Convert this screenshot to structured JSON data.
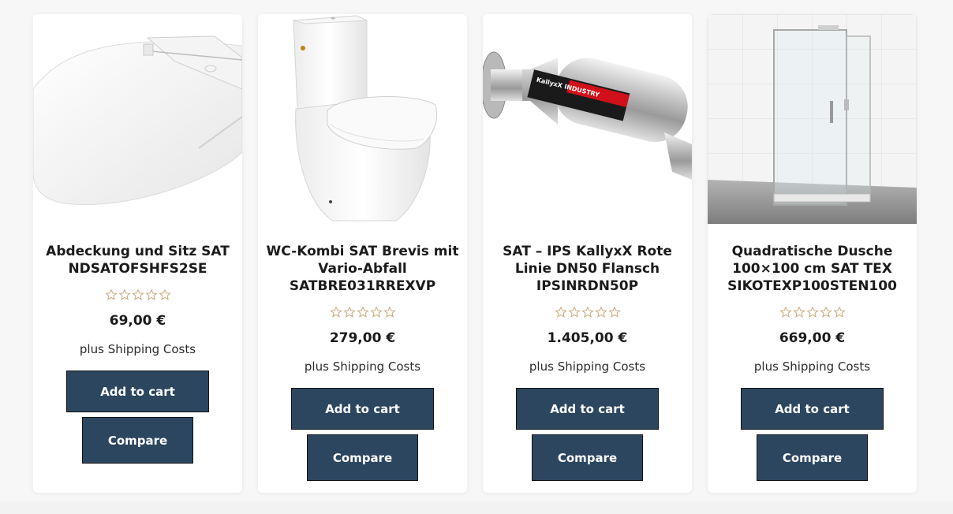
{
  "products": [
    {
      "title": "Abdeckung und Sitz SAT NDSATOFSHFS2SE",
      "price": "69,00 €",
      "shipping_prefix": "plus",
      "shipping_link": "Shipping Costs",
      "rating": 0,
      "add_to_cart": "Add to cart",
      "compare": "Compare",
      "image_icon": "toilet-seat-image"
    },
    {
      "title": "WC-Kombi SAT Brevis mit Vario-Abfall SATBRE031RREXVP",
      "price": "279,00 €",
      "shipping_prefix": "plus",
      "shipping_link": "Shipping Costs",
      "rating": 0,
      "add_to_cart": "Add to cart",
      "compare": "Compare",
      "image_icon": "toilet-image"
    },
    {
      "title": "SAT – IPS KallyxX Rote Linie DN50 Flansch IPSINRDN50P",
      "price": "1.405,00 €",
      "shipping_prefix": "plus",
      "shipping_link": "Shipping Costs",
      "rating": 0,
      "add_to_cart": "Add to cart",
      "compare": "Compare",
      "image_icon": "water-treatment-pipe-image",
      "image_label": "KallyxX INDUSTRY"
    },
    {
      "title": "Quadratische Dusche 100×100 cm SAT TEX SIKOTEXP100STEN100",
      "price": "669,00 €",
      "shipping_prefix": "plus",
      "shipping_link": "Shipping Costs",
      "rating": 0,
      "add_to_cart": "Add to cart",
      "compare": "Compare",
      "image_icon": "shower-enclosure-image"
    }
  ],
  "colors": {
    "button_bg": "#2c4660",
    "star_outline": "#c8a97e"
  }
}
